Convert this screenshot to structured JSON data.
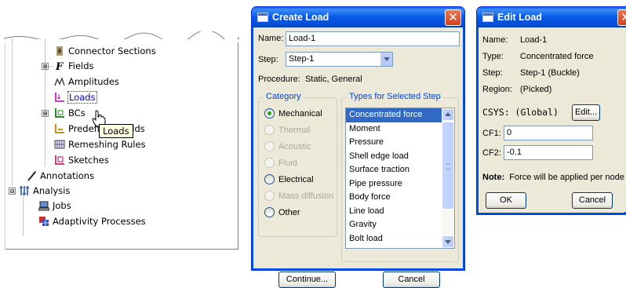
{
  "tree": {
    "items": [
      {
        "label": "Connector Sections"
      },
      {
        "label": "Fields",
        "expander": "⊞"
      },
      {
        "label": "Amplitudes"
      },
      {
        "label": "Loads"
      },
      {
        "label": "BCs",
        "expander": "⊞"
      },
      {
        "label": "Predefined Fields"
      },
      {
        "label": "Remeshing Rules"
      },
      {
        "label": "Sketches"
      },
      {
        "label": "Annotations"
      },
      {
        "label": "Analysis",
        "expander": "⊟"
      },
      {
        "label": "Jobs"
      },
      {
        "label": "Adaptivity Processes"
      }
    ],
    "tooltip": "Loads"
  },
  "create_load": {
    "title": "Create Load",
    "name_label": "Name:",
    "name_value": "Load-1",
    "step_label": "Step:",
    "step_value": "Step-1",
    "procedure_label": "Procedure:",
    "procedure_value": "Static, General",
    "category_title": "Category",
    "categories": [
      {
        "label": "Mechanical",
        "checked": true,
        "enabled": true
      },
      {
        "label": "Thermal",
        "checked": false,
        "enabled": false
      },
      {
        "label": "Acoustic",
        "checked": false,
        "enabled": false
      },
      {
        "label": "Fluid",
        "checked": false,
        "enabled": false
      },
      {
        "label": "Electrical",
        "checked": false,
        "enabled": true
      },
      {
        "label": "Mass diffusion",
        "checked": false,
        "enabled": false
      },
      {
        "label": "Other",
        "checked": false,
        "enabled": true
      }
    ],
    "types_title": "Types for Selected Step",
    "types": [
      "Concentrated force",
      "Moment",
      "Pressure",
      "Shell edge load",
      "Surface traction",
      "Pipe pressure",
      "Body force",
      "Line load",
      "Gravity",
      "Bolt load"
    ],
    "selected_type": "Concentrated force",
    "continue_label": "Continue...",
    "cancel_label": "Cancel"
  },
  "edit_load": {
    "title": "Edit Load",
    "name_label": "Name:",
    "name_value": "Load-1",
    "type_label": "Type:",
    "type_value": "Concentrated force",
    "step_label": "Step:",
    "step_value": "Step-1 (Buckle)",
    "region_label": "Region:",
    "region_value": "(Picked)",
    "csys_label": "CSYS: (Global)",
    "edit_label": "Edit...",
    "cf1_label": "CF1:",
    "cf1_value": "0",
    "cf2_label": "CF2:",
    "cf2_value": "-0.1",
    "note_bold": "Note:",
    "note_text": "Force will be applied per node",
    "ok_label": "OK",
    "cancel_label": "Cancel"
  },
  "colors": {
    "title_blue": "#0758e6",
    "selection": "#316ac5",
    "group_title": "#0046d5",
    "close_red": "#d1401c"
  }
}
